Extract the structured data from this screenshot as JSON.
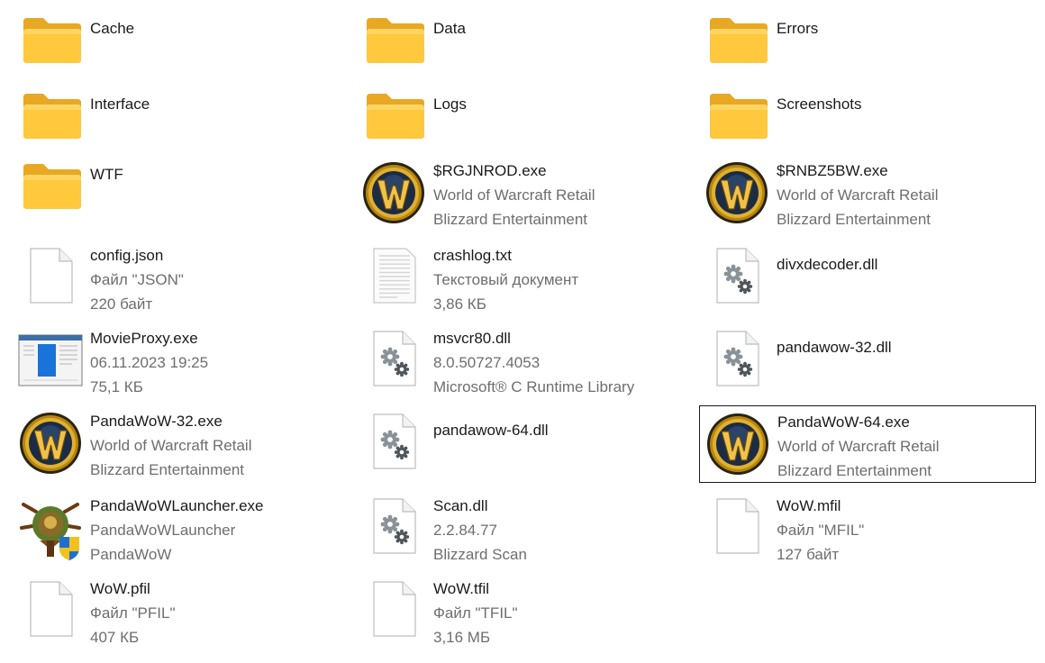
{
  "items": [
    {
      "name": "Cache",
      "line2": "",
      "line3": "",
      "icon": "folder-icon"
    },
    {
      "name": "Data",
      "line2": "",
      "line3": "",
      "icon": "folder-with-documents-icon"
    },
    {
      "name": "Errors",
      "line2": "",
      "line3": "",
      "icon": "folder-with-documents-icon"
    },
    {
      "name": "Interface",
      "line2": "",
      "line3": "",
      "icon": "folder-icon"
    },
    {
      "name": "Logs",
      "line2": "",
      "line3": "",
      "icon": "folder-with-documents-icon"
    },
    {
      "name": "Screenshots",
      "line2": "",
      "line3": "",
      "icon": "folder-with-screenshot-icon"
    },
    {
      "name": "WTF",
      "line2": "",
      "line3": "",
      "icon": "folder-with-documents-icon"
    },
    {
      "name": "$RGJNROD.exe",
      "line2": "World of Warcraft Retail",
      "line3": "Blizzard Entertainment",
      "icon": "wow-logo-icon"
    },
    {
      "name": "$RNBZ5BW.exe",
      "line2": "World of Warcraft Retail",
      "line3": "Blizzard Entertainment",
      "icon": "wow-logo-icon"
    },
    {
      "name": "config.json",
      "line2": "Файл \"JSON\"",
      "line3": "220 байт",
      "icon": "blank-file-icon"
    },
    {
      "name": "crashlog.txt",
      "line2": "Текстовый документ",
      "line3": "3,86 КБ",
      "icon": "text-file-icon"
    },
    {
      "name": "divxdecoder.dll",
      "line2": "",
      "line3": "",
      "icon": "dll-gear-file-icon"
    },
    {
      "name": "MovieProxy.exe",
      "line2": "06.11.2023 19:25",
      "line3": "75,1 КБ",
      "icon": "app-window-icon"
    },
    {
      "name": "msvcr80.dll",
      "line2": "8.0.50727.4053",
      "line3": "Microsoft® C Runtime Library",
      "icon": "dll-gear-file-icon"
    },
    {
      "name": "pandawow-32.dll",
      "line2": "",
      "line3": "",
      "icon": "dll-gear-file-icon"
    },
    {
      "name": "PandaWoW-32.exe",
      "line2": "World of Warcraft Retail",
      "line3": "Blizzard Entertainment",
      "icon": "wow-logo-icon"
    },
    {
      "name": "pandawow-64.dll",
      "line2": "",
      "line3": "",
      "icon": "dll-gear-file-icon"
    },
    {
      "name": "PandaWoW-64.exe",
      "line2": "World of Warcraft Retail",
      "line3": "Blizzard Entertainment",
      "icon": "wow-logo-icon",
      "selected": true
    },
    {
      "name": "PandaWoWLauncher.exe",
      "line2": "PandaWoWLauncher",
      "line3": "PandaWoW",
      "icon": "panda-launcher-shield-icon"
    },
    {
      "name": "Scan.dll",
      "line2": "2.2.84.77",
      "line3": "Blizzard Scan",
      "icon": "dll-gear-file-icon"
    },
    {
      "name": "WoW.mfil",
      "line2": "Файл \"MFIL\"",
      "line3": "127 байт",
      "icon": "blank-file-icon"
    },
    {
      "name": "WoW.pfil",
      "line2": "Файл \"PFIL\"",
      "line3": "407 КБ",
      "icon": "blank-file-icon"
    },
    {
      "name": "WoW.tfil",
      "line2": "Файл \"TFIL\"",
      "line3": "3,16 МБ",
      "icon": "blank-file-icon"
    }
  ],
  "colors": {
    "folder": "#ffc83d",
    "folder_back": "#e8a823",
    "selection_border": "#1a1a1a",
    "primary_text": "#1a1a1a",
    "secondary_text": "#6e6e6e"
  }
}
